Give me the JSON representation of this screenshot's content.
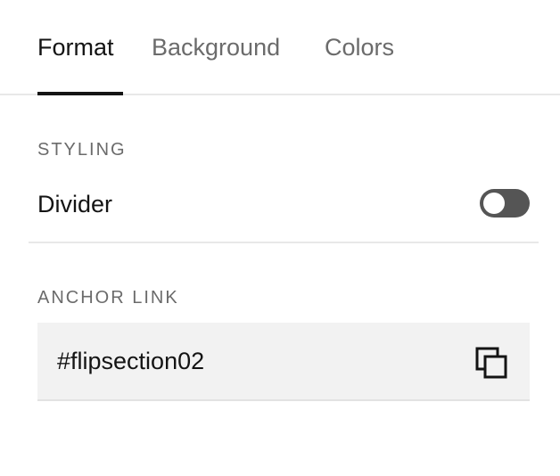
{
  "tabs": [
    {
      "label": "Format",
      "active": true
    },
    {
      "label": "Background",
      "active": false
    },
    {
      "label": "Colors",
      "active": false
    }
  ],
  "styling": {
    "header": "STYLING",
    "divider_label": "Divider",
    "divider_enabled": false
  },
  "anchor_link": {
    "header": "ANCHOR LINK",
    "value": "#flipsection02",
    "copy_icon": "copy-icon"
  },
  "colors": {
    "active_text": "#141414",
    "inactive_text": "#6b6b6b",
    "toggle_off": "#555555",
    "field_bg": "#f2f2f2",
    "rule": "#e8e8e8"
  }
}
